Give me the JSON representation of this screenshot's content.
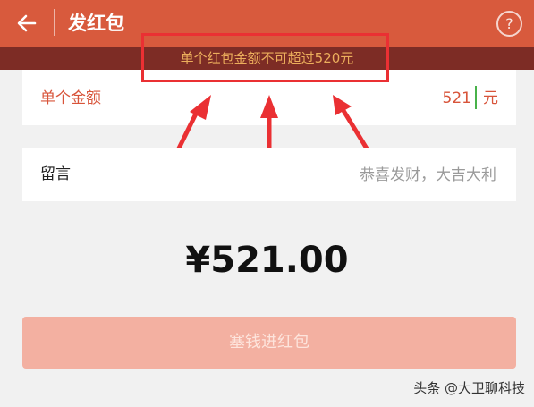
{
  "header": {
    "title": "发红包",
    "help_symbol": "?",
    "back_icon": "back-arrow-icon",
    "help_icon": "help-circle-icon",
    "background_color": "#d85a3d"
  },
  "warning": {
    "text": "单个红包金额不可超过520元",
    "text_color": "#ecae5c",
    "background_color": "#7d2c25"
  },
  "amount_field": {
    "label": "单个金额",
    "value": "521",
    "unit": "元",
    "text_color": "#d8543a"
  },
  "message_field": {
    "label": "留言",
    "placeholder": "恭喜发财，大吉大利"
  },
  "total": "¥521.00",
  "submit": {
    "label": "塞钱进红包",
    "background_color": "#f3b0a1"
  },
  "watermark": "头条 @大卫聊科技",
  "annotation": {
    "color": "#ea3033",
    "arrow_count": 3
  }
}
